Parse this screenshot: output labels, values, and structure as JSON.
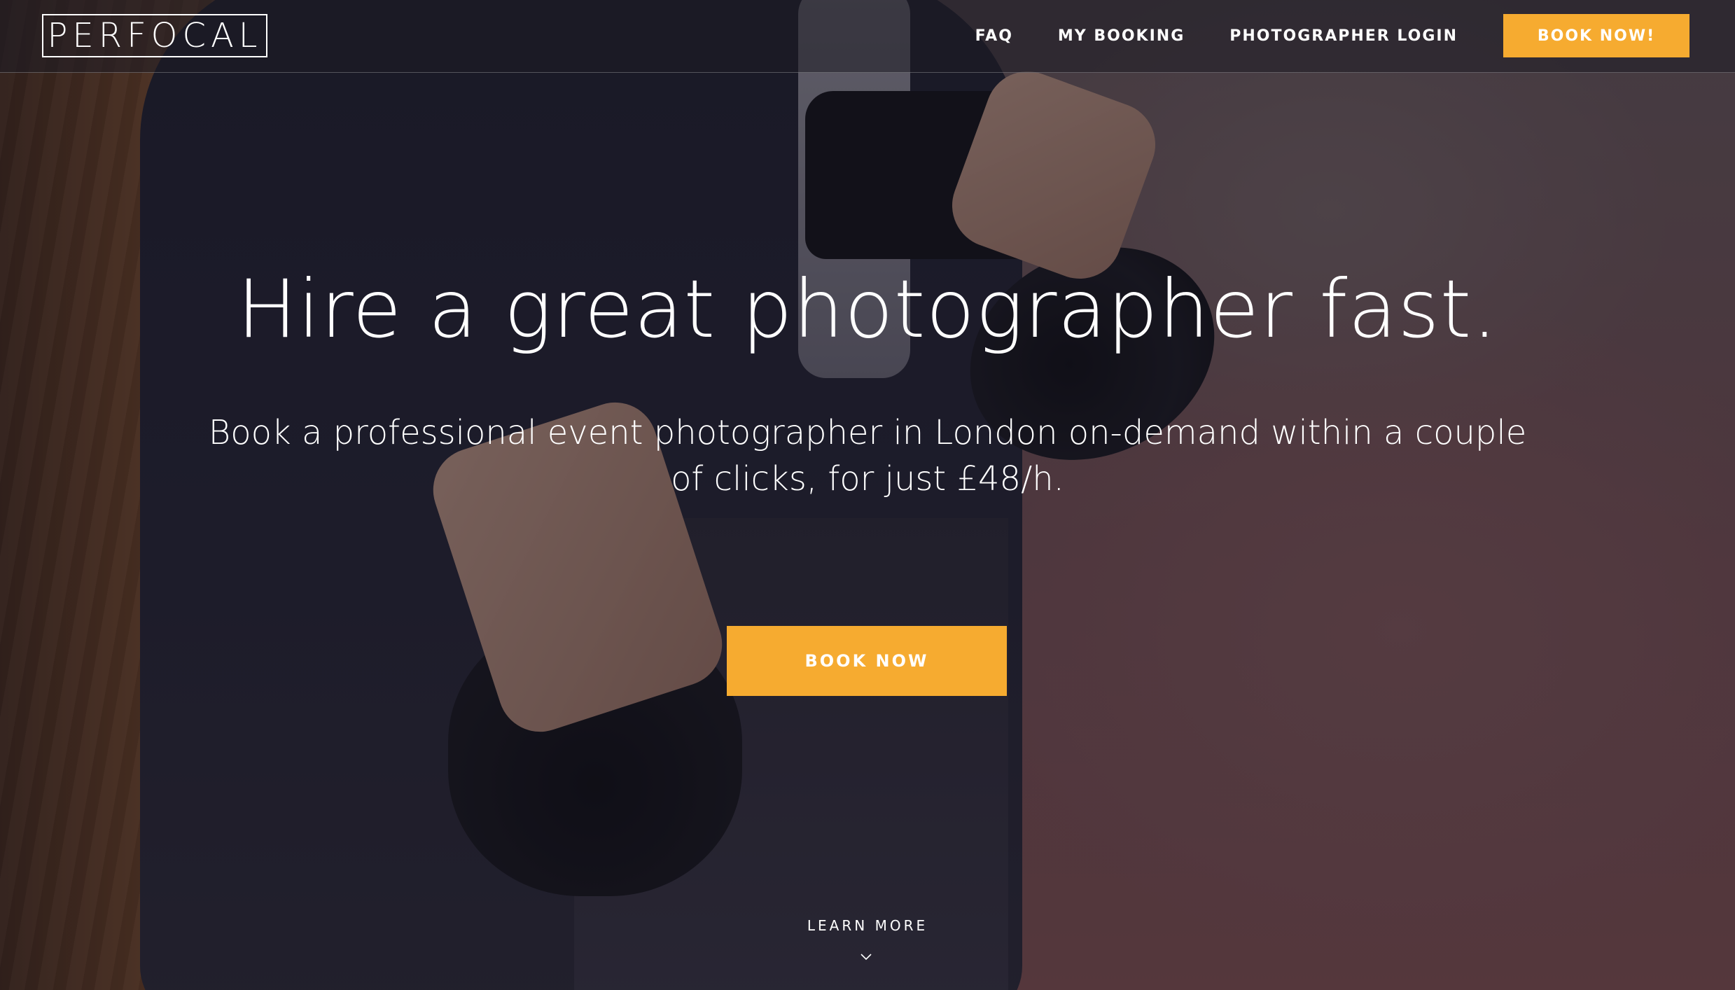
{
  "brand": {
    "logo_text": "PERFOCAL"
  },
  "nav": {
    "links": [
      {
        "label": "FAQ"
      },
      {
        "label": "MY BOOKING"
      },
      {
        "label": "PHOTOGRAPHER LOGIN"
      }
    ],
    "cta_label": "BOOK NOW!"
  },
  "hero": {
    "headline": "Hire a great photographer fast.",
    "subheadline": "Book a professional event photographer in London on-demand within a couple of clicks, for just £48/h.",
    "cta_label": "BOOK NOW",
    "learn_more_label": "LEARN MORE",
    "learn_more_icon": "chevron-down-icon"
  },
  "colors": {
    "accent": "#f6ab30",
    "text": "#ffffff",
    "overlay": "#14121c"
  }
}
